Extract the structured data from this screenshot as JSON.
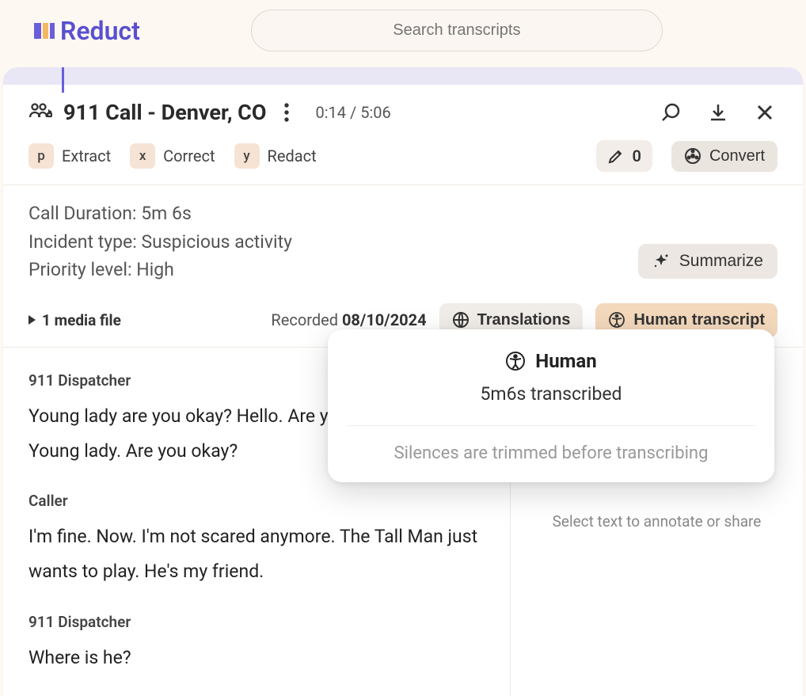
{
  "header": {
    "logo_text": "Reduct",
    "search_placeholder": "Search transcripts"
  },
  "doc": {
    "title": "911 Call - Denver, CO",
    "time_current": "0:14",
    "time_total": "5:06"
  },
  "tools": {
    "extract_key": "p",
    "extract_label": "Extract",
    "correct_key": "x",
    "correct_label": "Correct",
    "redact_key": "y",
    "redact_label": "Redact",
    "highlight_count": "0",
    "convert_label": "Convert"
  },
  "info": {
    "line1": "Call Duration: 5m 6s",
    "line2": "Incident type: Suspicious activity",
    "line3": "Priority level: High",
    "media_files": "1 media file",
    "recorded_prefix": "Recorded ",
    "recorded_date": "08/10/2024",
    "translations_label": "Translations",
    "human_transcript_label": "Human transcript",
    "summarize_label": "Summarize"
  },
  "transcript": [
    {
      "speaker": "911 Dispatcher",
      "text": "Young lady are you okay? Hello. Are you there? Hello? Young lady. Are you okay?"
    },
    {
      "speaker": "Caller",
      "text": "I'm fine. Now. I'm not scared anymore. The Tall Man just wants to play. He's my friend."
    },
    {
      "speaker": "911 Dispatcher",
      "text": "Where is he?"
    }
  ],
  "sidebar": {
    "hint": "Select text to annotate or share"
  },
  "popover": {
    "title": "Human",
    "sub": "5m6s transcribed",
    "note": "Silences are trimmed before transcribing"
  }
}
